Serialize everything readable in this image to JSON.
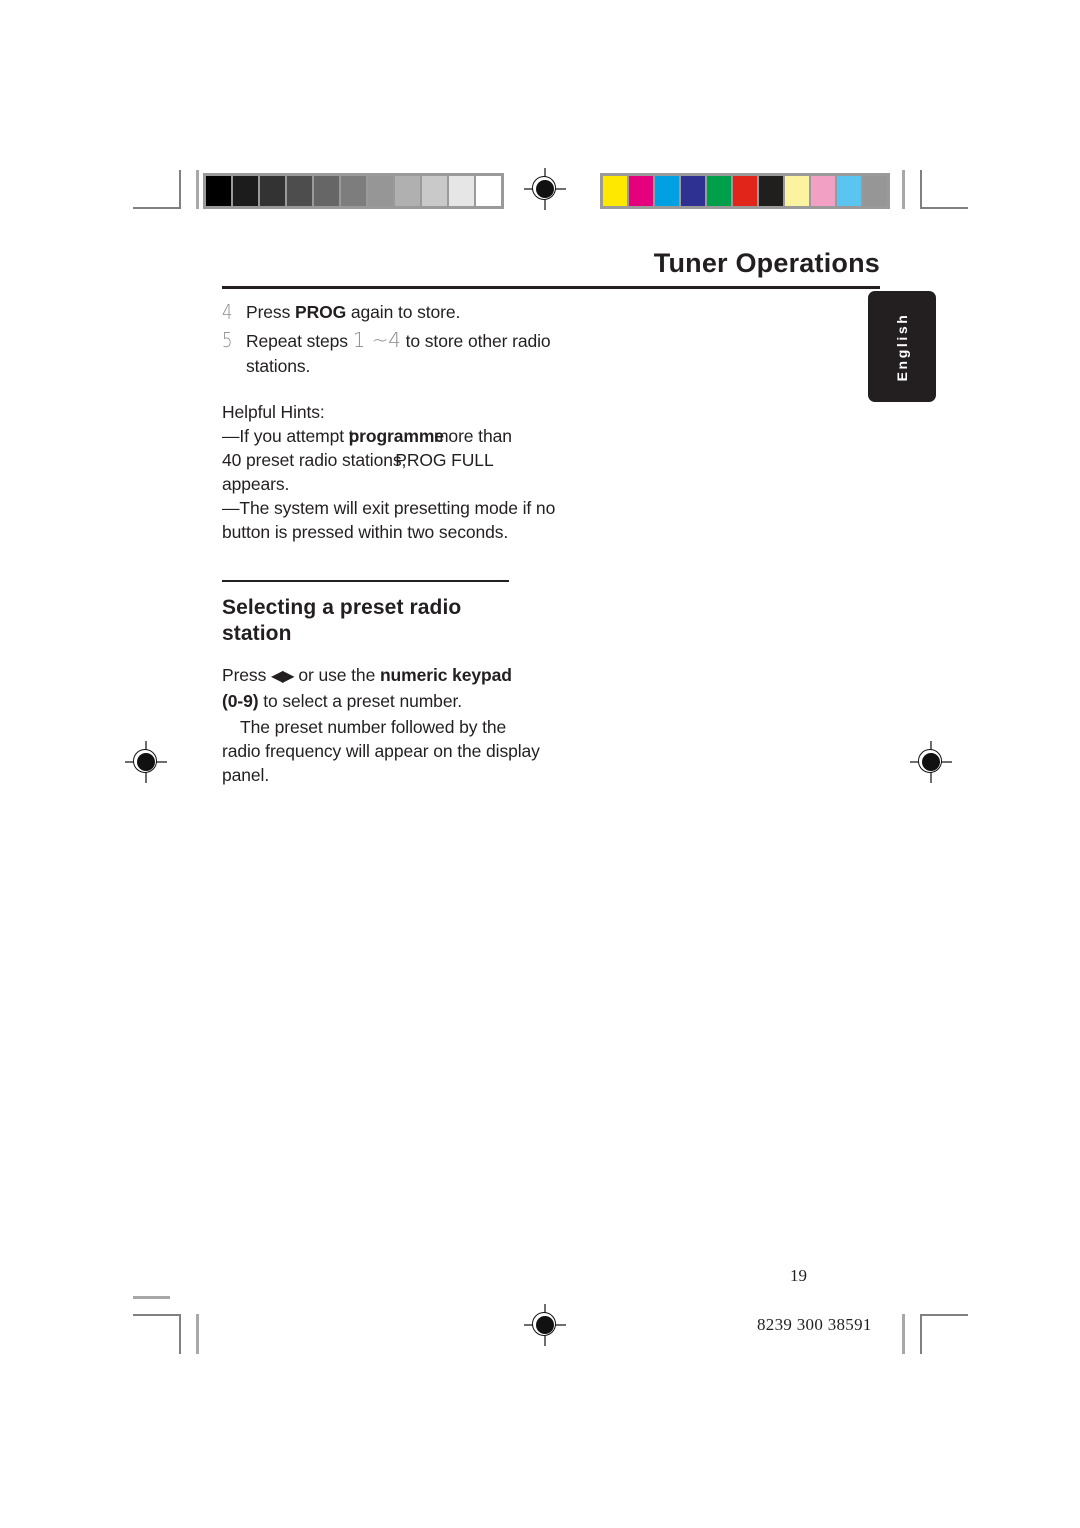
{
  "header": {
    "title": "Tuner Operations"
  },
  "language_tab": {
    "label": "English"
  },
  "steps": [
    {
      "number": "4",
      "text_before": "Press ",
      "bold": "PROG",
      "text_after": " again to store."
    },
    {
      "number": "5",
      "text_before": "Repeat steps ",
      "range_from": "1",
      "range_sep": " ~",
      "range_to": "4",
      "text_after": " to store other radio",
      "text_line2": "stations."
    }
  ],
  "hints": {
    "heading": "Helpful Hints:",
    "items": [
      {
        "dash": "—",
        "l1_a": "If you attempt t",
        "l1_b": "programme",
        "l1_c": "more than",
        "l2_a": "40 preset radio stations,",
        "l2_b": "PROG FULL",
        "l3": "appears."
      },
      {
        "dash": "—",
        "l1": "The system will exit presetting mode if no",
        "l2": "button is pressed within two seconds."
      }
    ]
  },
  "section": {
    "title_line1": "Selecting a preset radio",
    "title_line2": "station",
    "paragraph1": {
      "a": "Press ",
      "arrows": "◀▶",
      "b": " or use the ",
      "bold1": "numeric keypad",
      "c": "",
      "bold2": "(0-9)",
      "d": " to select a preset number."
    },
    "paragraph2": "The preset number followed by the radio frequency will appear on the display panel."
  },
  "footer": {
    "page_number": "19",
    "document_code": "8239 300 38591"
  },
  "calibration": {
    "grayscale": [
      "#000000",
      "#1c1c1c",
      "#333333",
      "#4d4d4d",
      "#666666",
      "#7d7d7d",
      "#969696",
      "#b0b0b0",
      "#c9c9c9",
      "#e6e6e6",
      "#ffffff"
    ],
    "colors": [
      "#ffe800",
      "#e5007e",
      "#00a0e3",
      "#2e3191",
      "#00a04b",
      "#e1251b",
      "#211e1e",
      "#fbf3a0",
      "#f2a0c3",
      "#5bc5f2",
      "#969696"
    ]
  }
}
